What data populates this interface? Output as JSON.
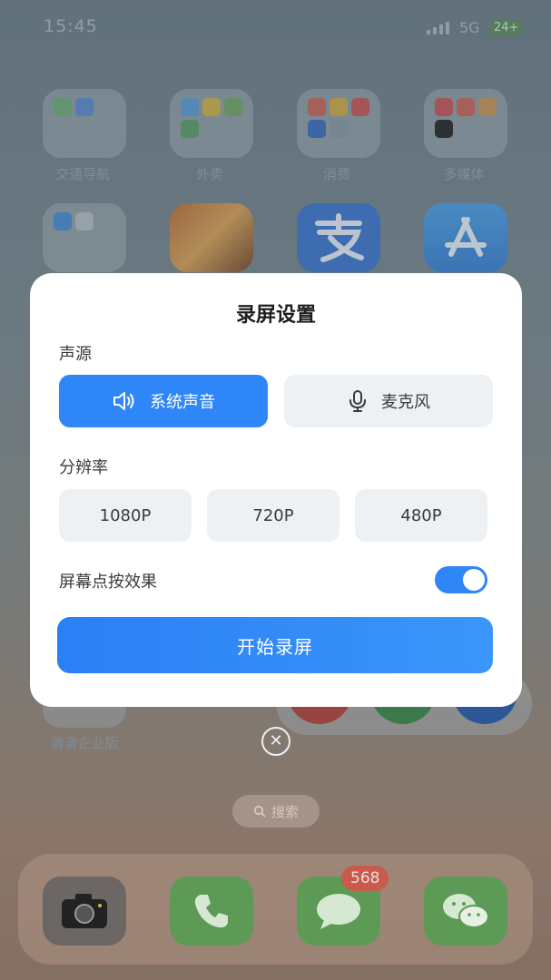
{
  "status_bar": {
    "time": "15:45",
    "network": "5G",
    "battery": "24+"
  },
  "home": {
    "folders": [
      {
        "label": "交通导航"
      },
      {
        "label": "外卖"
      },
      {
        "label": "消费"
      },
      {
        "label": "多媒体"
      }
    ],
    "bottom_label": "滴滴企业版"
  },
  "dialog": {
    "title": "录屏设置",
    "sound_source_label": "声源",
    "sound_options": [
      {
        "label": "系统声音",
        "icon": "speaker-icon",
        "selected": true
      },
      {
        "label": "麦克风",
        "icon": "microphone-icon",
        "selected": false
      }
    ],
    "resolution_label": "分辨率",
    "resolutions": [
      "1080P",
      "720P",
      "480P"
    ],
    "touch_effect_label": "屏幕点按效果",
    "touch_effect_on": true,
    "start_button": "开始录屏",
    "accent_color": "#2F86F6"
  },
  "search_pill": "搜索",
  "dock": {
    "messages_badge": "568"
  }
}
